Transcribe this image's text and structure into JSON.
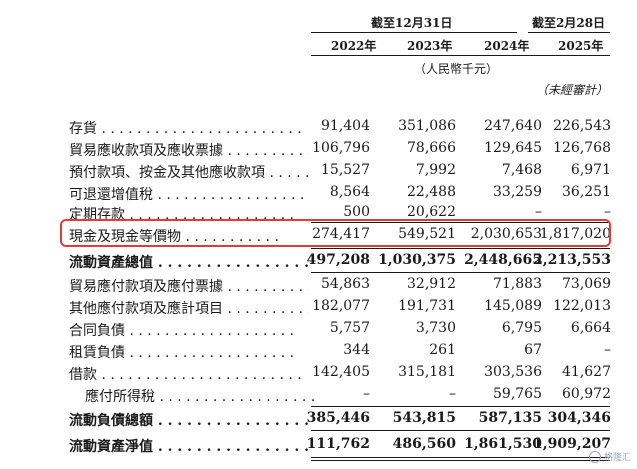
{
  "header": {
    "group1_title": "截至12月31日",
    "group2_title": "截至2月28日",
    "years": [
      "2022年",
      "2023年",
      "2024年",
      "2025年"
    ],
    "unit": "（人民幣千元）",
    "unaudited_note": "（未經審計）"
  },
  "rows": [
    {
      "label": "存貨",
      "values": [
        "91,404",
        "351,086",
        "247,640",
        "226,543"
      ]
    },
    {
      "label": "貿易應收款項及應收票據",
      "values": [
        "106,796",
        "78,666",
        "129,645",
        "126,768"
      ]
    },
    {
      "label": "預付款項、按金及其他應收款項",
      "values": [
        "15,527",
        "7,992",
        "7,468",
        "6,971"
      ]
    },
    {
      "label": "可退還增值稅",
      "values": [
        "8,564",
        "22,488",
        "33,259",
        "36,251"
      ]
    },
    {
      "label": "定期存款",
      "values": [
        "",
        "500",
        "20,622",
        "–",
        "–"
      ]
    },
    {
      "label": "現金及現金等價物",
      "values": [
        "274,417",
        "549,521",
        "2,030,653",
        "1,817,020"
      ]
    },
    {
      "label": "流動資產總值",
      "values": [
        "497,208",
        "1,030,375",
        "2,448,665",
        "2,213,553"
      ]
    },
    {
      "label": "貿易應付款項及應付票據",
      "values": [
        "54,863",
        "32,912",
        "71,883",
        "73,069"
      ]
    },
    {
      "label": "其他應付款項及應計項目",
      "values": [
        "182,077",
        "191,731",
        "145,089",
        "122,013"
      ]
    },
    {
      "label": "合同負債",
      "values": [
        "5,757",
        "3,730",
        "6,795",
        "6,664"
      ]
    },
    {
      "label": "租賃負債",
      "values": [
        "344",
        "261",
        "67",
        "–"
      ]
    },
    {
      "label": "借款",
      "values": [
        "142,405",
        "315,181",
        "303,536",
        "41,627"
      ]
    },
    {
      "label": "應付所得稅",
      "values": [
        "–",
        "–",
        "59,765",
        "60,972"
      ]
    },
    {
      "label": "流動負債總額",
      "values": [
        "385,446",
        "543,815",
        "587,135",
        "304,346"
      ]
    },
    {
      "label": "流動資產淨值",
      "values": [
        "111,762",
        "486,560",
        "1,861,530",
        "1,909,207"
      ]
    }
  ],
  "watermark": "格隆汇"
}
